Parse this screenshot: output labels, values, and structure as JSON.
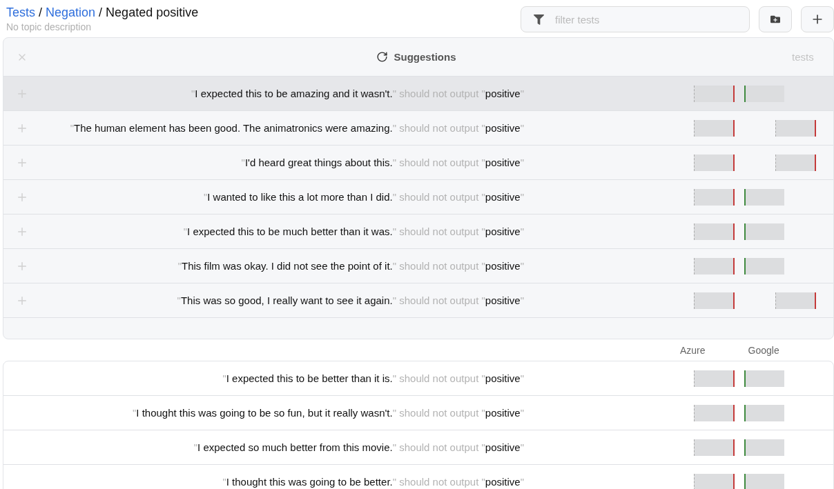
{
  "breadcrumb": {
    "links": [
      "Tests",
      "Negation"
    ],
    "separator": "/",
    "current": "Negated positive"
  },
  "description": {
    "placeholder": "No topic description"
  },
  "filter": {
    "placeholder": "filter tests"
  },
  "quote": "\"",
  "suggestions": {
    "title": "Suggestions",
    "count_label": "tests",
    "rows": [
      {
        "input": "I expected this to be amazing and it wasn't.",
        "comparator": "should not output",
        "output": "positive",
        "selected": true,
        "scores": [
          {
            "pass": false
          },
          {
            "pass": true
          }
        ]
      },
      {
        "input": "The human element has been good. The animatronics were amazing.",
        "comparator": "should not output",
        "output": "positive",
        "selected": false,
        "scores": [
          {
            "pass": false
          },
          {
            "pass": false
          }
        ]
      },
      {
        "input": "I'd heard great things about this.",
        "comparator": "should not output",
        "output": "positive",
        "selected": false,
        "scores": [
          {
            "pass": false
          },
          {
            "pass": false
          }
        ]
      },
      {
        "input": "I wanted to like this a lot more than I did.",
        "comparator": "should not output",
        "output": "positive",
        "selected": false,
        "scores": [
          {
            "pass": false
          },
          {
            "pass": true
          }
        ]
      },
      {
        "input": "I expected this to be much better than it was.",
        "comparator": "should not output",
        "output": "positive",
        "selected": false,
        "scores": [
          {
            "pass": false
          },
          {
            "pass": true
          }
        ]
      },
      {
        "input": "This film was okay. I did not see the point of it.",
        "comparator": "should not output",
        "output": "positive",
        "selected": false,
        "scores": [
          {
            "pass": false
          },
          {
            "pass": true
          }
        ]
      },
      {
        "input": "This was so good, I really want to see it again.",
        "comparator": "should not output",
        "output": "positive",
        "selected": false,
        "scores": [
          {
            "pass": false
          },
          {
            "pass": false
          }
        ]
      }
    ]
  },
  "models": [
    "Azure",
    "Google"
  ],
  "tests": [
    {
      "input": "I expected this to be better than it is.",
      "comparator": "should not output",
      "output": "positive",
      "scores": [
        {
          "pass": false
        },
        {
          "pass": true
        }
      ]
    },
    {
      "input": "I thought this was going to be so fun, but it really wasn't.",
      "comparator": "should not output",
      "output": "positive",
      "scores": [
        {
          "pass": false
        },
        {
          "pass": true
        }
      ]
    },
    {
      "input": "I expected so much better from this movie.",
      "comparator": "should not output",
      "output": "positive",
      "scores": [
        {
          "pass": false
        },
        {
          "pass": true
        }
      ]
    },
    {
      "input": "I thought this was going to be better.",
      "comparator": "should not output",
      "output": "positive",
      "scores": [
        {
          "pass": false
        },
        {
          "pass": true
        }
      ]
    }
  ]
}
